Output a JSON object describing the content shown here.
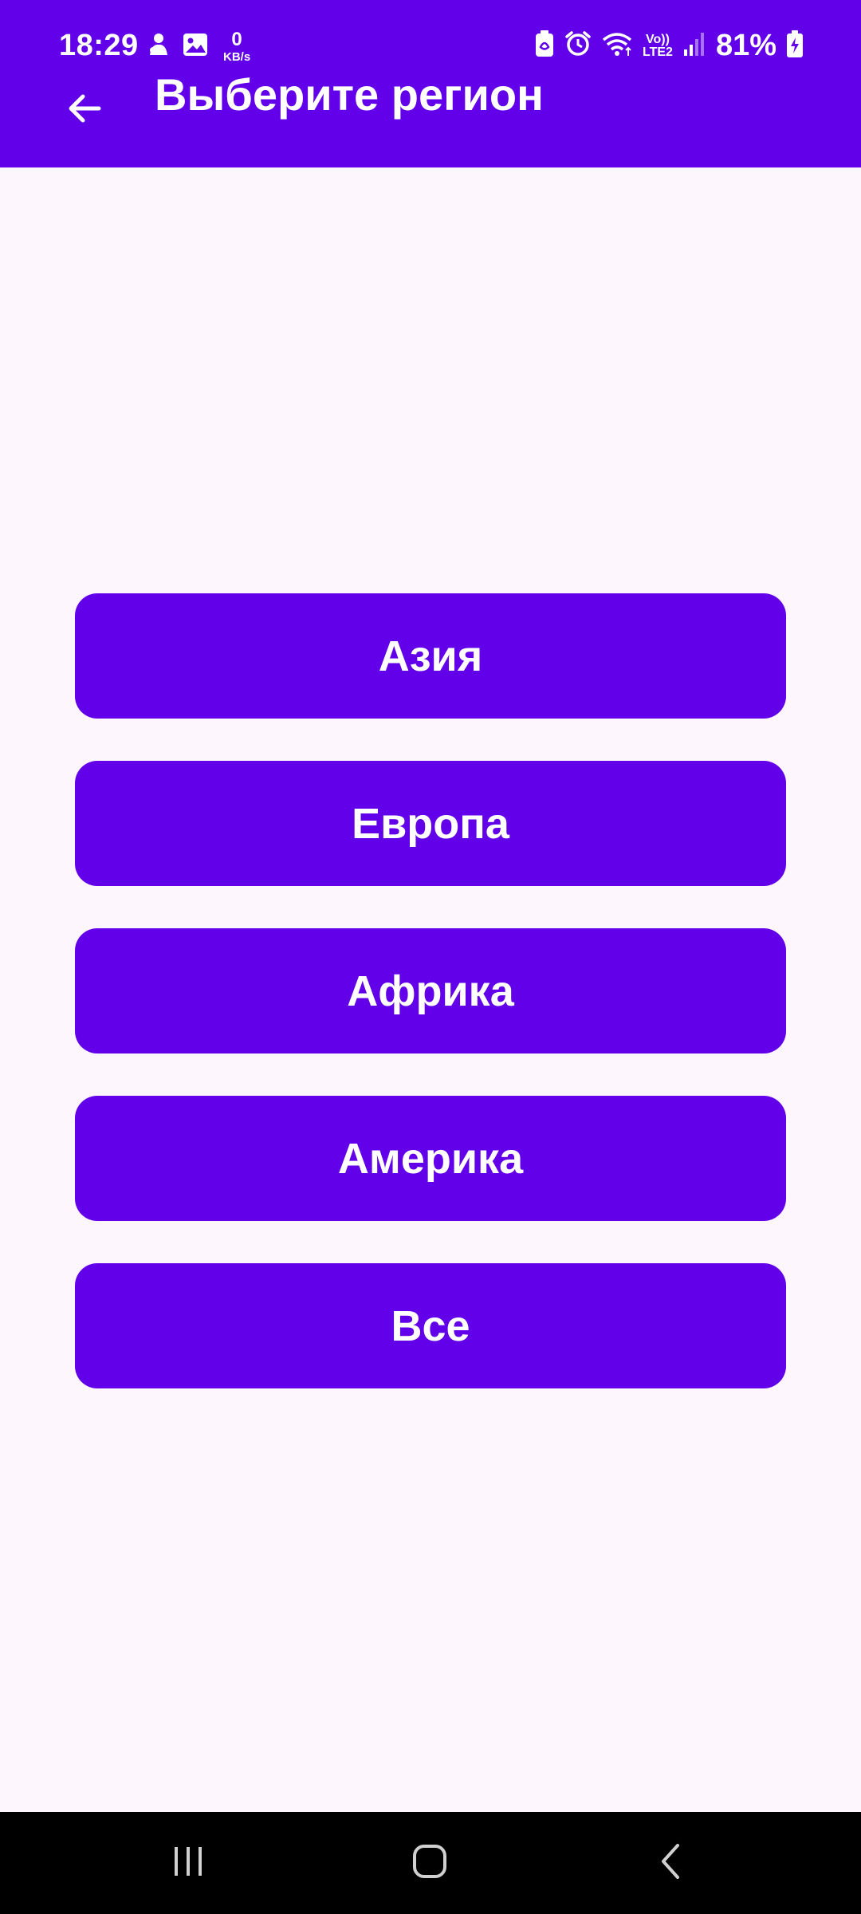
{
  "status_bar": {
    "time": "18:29",
    "net_speed_value": "0",
    "net_speed_unit": "KB/s",
    "volte_top": "Vo))",
    "volte_bottom": "LTE2",
    "battery_percent": "81%",
    "icons": [
      "notification-app-icon",
      "gallery-icon",
      "battery-saver-icon",
      "alarm-icon",
      "wifi-icon",
      "signal-icon",
      "battery-charging-icon"
    ]
  },
  "app_bar": {
    "title": "Выберите регион",
    "back_icon": "arrow-back-icon"
  },
  "regions": [
    {
      "label": "Азия"
    },
    {
      "label": "Европа"
    },
    {
      "label": "Африка"
    },
    {
      "label": "Америка"
    },
    {
      "label": "Все"
    }
  ],
  "nav_bar": {
    "buttons": [
      "recents-icon",
      "home-icon",
      "back-icon"
    ]
  },
  "colors": {
    "primary": "#6200ea",
    "background": "#fdf7fd",
    "on_primary": "#ffffff",
    "nav_background": "#000000"
  }
}
